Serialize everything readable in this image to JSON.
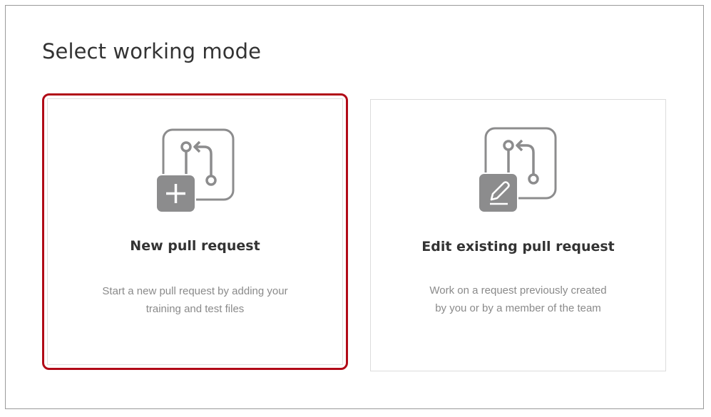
{
  "page": {
    "title": "Select working mode"
  },
  "modes": [
    {
      "id": "new",
      "title": "New pull request",
      "description_lines": [
        "Start a new pull request by adding your",
        "training and test files"
      ],
      "icon": "pull-request-plus-icon",
      "selected": true
    },
    {
      "id": "edit",
      "title": "Edit existing pull request",
      "description_lines": [
        "Work on a request previously created",
        "by you or by a member of the team"
      ],
      "icon": "pull-request-edit-icon",
      "selected": false
    }
  ],
  "colors": {
    "selected_border": "#b10a17",
    "icon_gray": "#8c8c8d",
    "title_text": "#333333",
    "desc_text": "#8a8a8a"
  }
}
